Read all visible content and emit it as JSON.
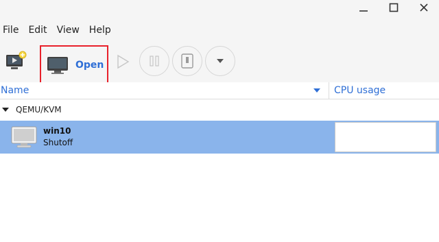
{
  "window": {
    "icons": {
      "minimize": "minimize-icon",
      "maximize": "maximize-icon",
      "close": "close-icon"
    }
  },
  "menubar": {
    "items": [
      "File",
      "Edit",
      "View",
      "Help"
    ]
  },
  "toolbar": {
    "new_icon": "new-vm-icon",
    "open_label": "Open",
    "open_icon": "monitor-icon",
    "run_icon": "play-icon",
    "pause_icon": "pause-icon",
    "shutdown_icon": "shutdown-icon",
    "menu_icon": "chevron-down-icon",
    "highlight_color": "#e8202a"
  },
  "columns": {
    "name": "Name",
    "cpu": "CPU usage",
    "sort": "descending"
  },
  "connections": [
    {
      "label": "QEMU/KVM",
      "expanded": true,
      "vms": [
        {
          "name": "win10",
          "status": "Shutoff",
          "selected": true,
          "cpu_usage": 0
        }
      ]
    }
  ],
  "colors": {
    "accent": "#2f6fd6",
    "selection": "#8ab4eb",
    "chrome": "#f5f5f5"
  }
}
